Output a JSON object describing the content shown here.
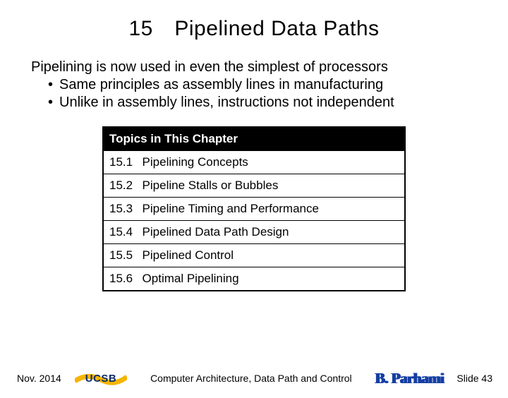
{
  "title": "15 Pipelined Data Paths",
  "intro": {
    "line": "Pipelining is now used in even the simplest of processors",
    "bullets": [
      "Same principles as assembly lines in manufacturing",
      "Unlike in assembly lines, instructions not independent"
    ]
  },
  "topics": {
    "header": "Topics in This Chapter",
    "rows": [
      {
        "num": "15.1",
        "title": "Pipelining Concepts"
      },
      {
        "num": "15.2",
        "title": "Pipeline Stalls or Bubbles"
      },
      {
        "num": "15.3",
        "title": "Pipeline Timing and Performance"
      },
      {
        "num": "15.4",
        "title": "Pipelined Data Path Design"
      },
      {
        "num": "15.5",
        "title": "Pipelined Control"
      },
      {
        "num": "15.6",
        "title": "Optimal Pipelining"
      }
    ]
  },
  "footer": {
    "date": "Nov. 2014",
    "logo": "UCSB",
    "center": "Computer Architecture, Data Path and Control",
    "author": "B. Parhami",
    "slide": "Slide 43"
  }
}
